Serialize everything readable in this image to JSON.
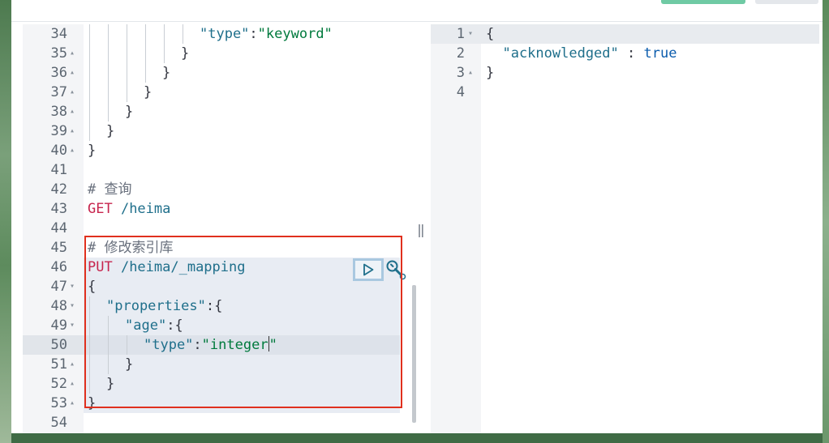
{
  "request_editor": {
    "lines": [
      {
        "num": "34",
        "fold": "",
        "indent": 6,
        "tokens": [
          {
            "t": "\"type\"",
            "c": "key"
          },
          {
            "t": ":",
            "c": "ptx"
          },
          {
            "t": "\"keyword\"",
            "c": "str"
          }
        ]
      },
      {
        "num": "35",
        "fold": "▴",
        "indent": 5,
        "tokens": [
          {
            "t": "}",
            "c": "ptx"
          }
        ]
      },
      {
        "num": "36",
        "fold": "▴",
        "indent": 4,
        "tokens": [
          {
            "t": "}",
            "c": "ptx"
          }
        ]
      },
      {
        "num": "37",
        "fold": "▴",
        "indent": 3,
        "tokens": [
          {
            "t": "}",
            "c": "ptx"
          }
        ]
      },
      {
        "num": "38",
        "fold": "▴",
        "indent": 2,
        "tokens": [
          {
            "t": "}",
            "c": "ptx"
          }
        ]
      },
      {
        "num": "39",
        "fold": "▴",
        "indent": 1,
        "tokens": [
          {
            "t": "}",
            "c": "ptx"
          }
        ]
      },
      {
        "num": "40",
        "fold": "▴",
        "indent": 0,
        "tokens": [
          {
            "t": "}",
            "c": "ptx"
          }
        ]
      },
      {
        "num": "41",
        "fold": "",
        "indent": 0,
        "tokens": []
      },
      {
        "num": "42",
        "fold": "",
        "indent": 0,
        "tokens": [
          {
            "t": "# 查询",
            "c": "cmt"
          }
        ]
      },
      {
        "num": "43",
        "fold": "",
        "indent": 0,
        "tokens": [
          {
            "t": "GET",
            "c": "mth"
          },
          {
            "t": " /heima",
            "c": "url"
          }
        ]
      },
      {
        "num": "44",
        "fold": "",
        "indent": 0,
        "tokens": []
      },
      {
        "num": "45",
        "fold": "",
        "indent": 0,
        "tokens": [
          {
            "t": "# 修改索引库",
            "c": "cmt"
          }
        ]
      },
      {
        "num": "46",
        "fold": "",
        "indent": 0,
        "tokens": [
          {
            "t": "PUT",
            "c": "mth"
          },
          {
            "t": " /heima/_mapping",
            "c": "url"
          }
        ]
      },
      {
        "num": "47",
        "fold": "▾",
        "indent": 0,
        "tokens": [
          {
            "t": "{",
            "c": "ptx"
          }
        ]
      },
      {
        "num": "48",
        "fold": "▾",
        "indent": 1,
        "tokens": [
          {
            "t": "\"properties\"",
            "c": "key"
          },
          {
            "t": ":{",
            "c": "ptx"
          }
        ]
      },
      {
        "num": "49",
        "fold": "▾",
        "indent": 2,
        "tokens": [
          {
            "t": "\"age\"",
            "c": "key"
          },
          {
            "t": ":{",
            "c": "ptx"
          }
        ]
      },
      {
        "num": "50",
        "fold": "",
        "indent": 3,
        "tokens": [
          {
            "t": "\"type\"",
            "c": "key"
          },
          {
            "t": ":",
            "c": "ptx"
          },
          {
            "t": "\"integer",
            "c": "str"
          },
          {
            "t": "CARET",
            "c": "caret"
          },
          {
            "t": "\"",
            "c": "str"
          }
        ]
      },
      {
        "num": "51",
        "fold": "▴",
        "indent": 2,
        "tokens": [
          {
            "t": "}",
            "c": "ptx"
          }
        ]
      },
      {
        "num": "52",
        "fold": "▴",
        "indent": 1,
        "tokens": [
          {
            "t": "}",
            "c": "ptx"
          }
        ]
      },
      {
        "num": "53",
        "fold": "▴",
        "indent": 0,
        "tokens": [
          {
            "t": "}",
            "c": "ptx"
          }
        ]
      },
      {
        "num": "54",
        "fold": "",
        "indent": 0,
        "tokens": []
      }
    ],
    "active_line": "50",
    "run_icon": "play-icon",
    "settings_icon": "wrench-icon"
  },
  "response_viewer": {
    "lines": [
      {
        "num": "1",
        "fold": "▾",
        "tokens": [
          {
            "t": "{",
            "c": "ptx"
          }
        ]
      },
      {
        "num": "2",
        "fold": "",
        "tokens": [
          {
            "t": "  \"acknowledged\"",
            "c": "key"
          },
          {
            "t": " : ",
            "c": "ptx"
          },
          {
            "t": "true",
            "c": "kw"
          }
        ]
      },
      {
        "num": "3",
        "fold": "▴",
        "tokens": [
          {
            "t": "}",
            "c": "ptx"
          }
        ]
      },
      {
        "num": "4",
        "fold": "",
        "tokens": []
      }
    ]
  },
  "splitter_glyph": "‖",
  "colors": {
    "annotation_frame": "#e0301e",
    "primary_button": "#6fcaa4"
  }
}
